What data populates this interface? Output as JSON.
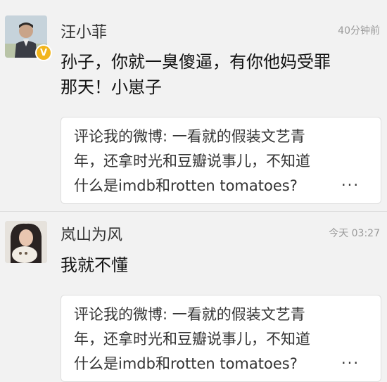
{
  "comments": [
    {
      "username": "汪小菲",
      "time": "40分钟前",
      "verified_badge": "V",
      "avatar_icon": "avatar-man-suit",
      "text_line1": "孙子，你就一臭傻逼，有你他妈受罪",
      "text_line2": "那天！小崽子",
      "quote": {
        "line1": "评论我的微博: 一看就的假装文艺青",
        "line2": "年，还拿时光和豆瓣说事儿，不知道",
        "line3": "什么是imdb和rotten tomatoes?",
        "more": "..."
      }
    },
    {
      "username": "岚山为风",
      "time": "今天 03:27",
      "avatar_icon": "avatar-woman-with-dog",
      "text_line1": "我就不懂",
      "quote": {
        "line1": "评论我的微博: 一看就的假装文艺青",
        "line2": "年，还拿时光和豆瓣说事儿，不知道",
        "line3": "什么是imdb和rotten tomatoes?",
        "more": "..."
      }
    }
  ],
  "colors": {
    "background": "#f2f2f2",
    "quote_background": "#ffffff",
    "badge": "#f2b51b",
    "timestamp": "#9a9a9a"
  }
}
